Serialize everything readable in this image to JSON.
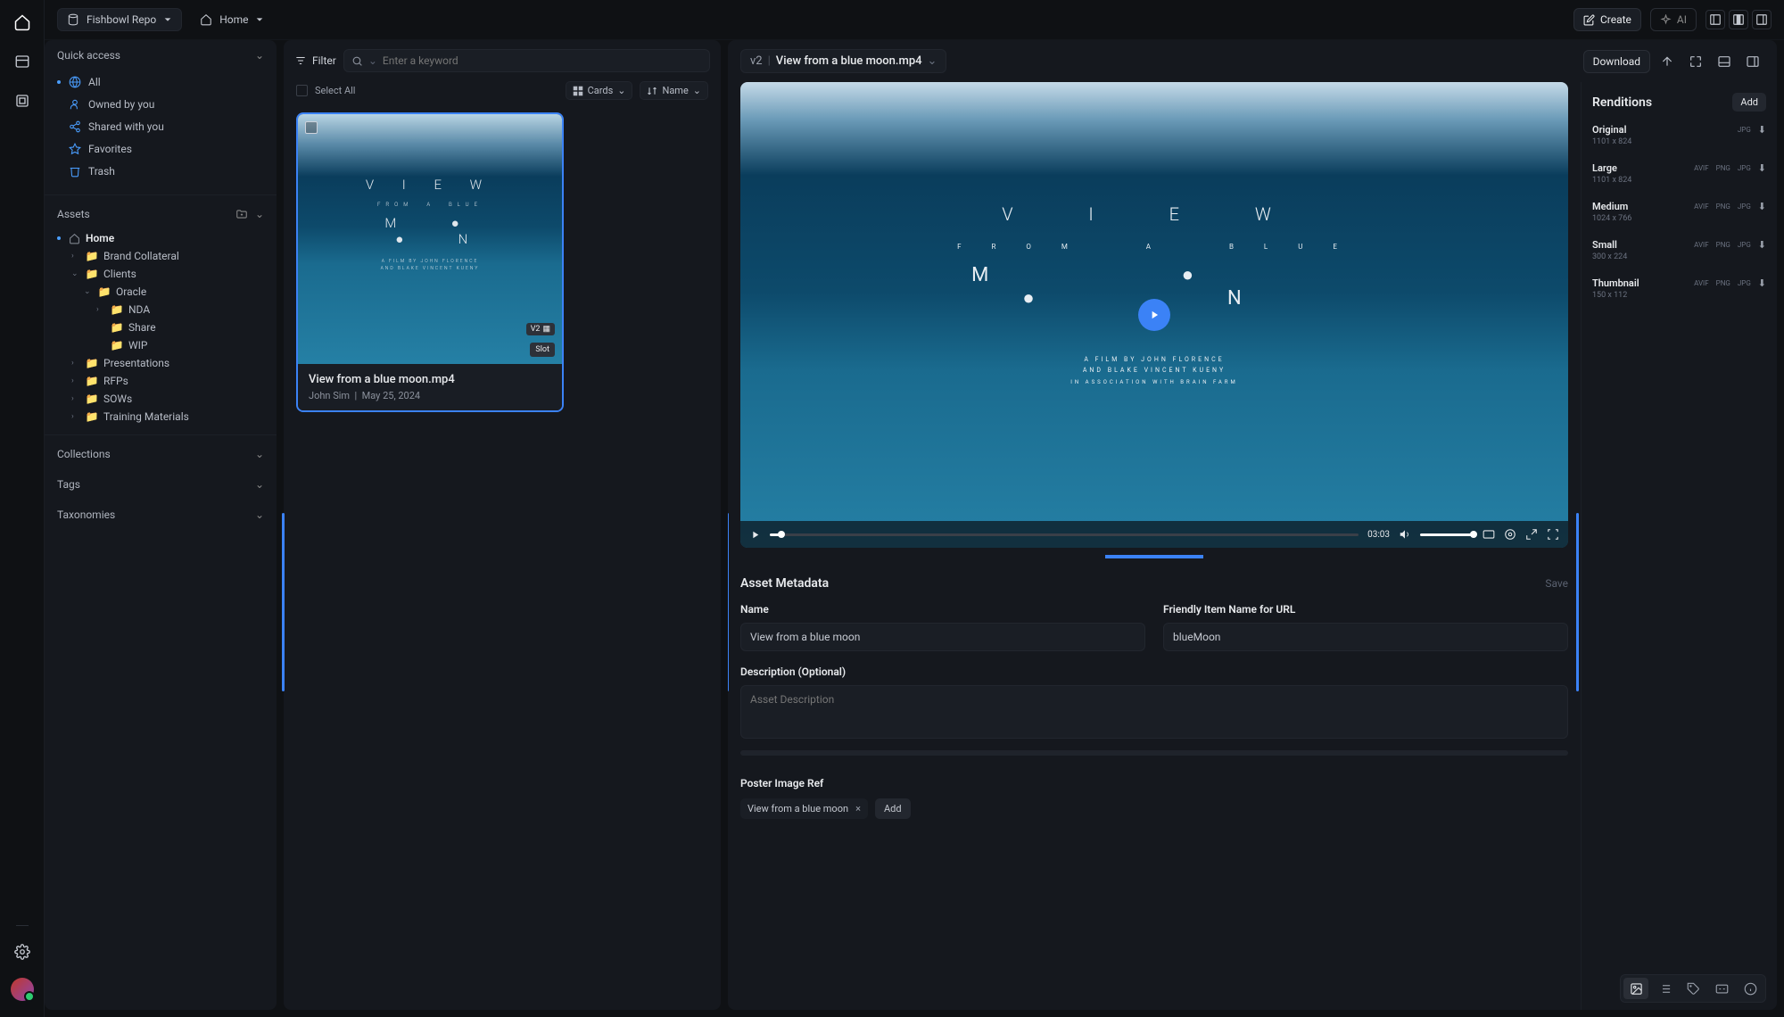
{
  "topbar": {
    "repo_label": "Fishbowl Repo",
    "breadcrumb_home": "Home",
    "create_label": "Create",
    "ai_label": "AI"
  },
  "sidebar": {
    "quick_access": {
      "title": "Quick access",
      "items": [
        {
          "label": "All",
          "icon": "globe",
          "current": true
        },
        {
          "label": "Owned by you",
          "icon": "user"
        },
        {
          "label": "Shared with you",
          "icon": "share"
        },
        {
          "label": "Favorites",
          "icon": "star"
        },
        {
          "label": "Trash",
          "icon": "trash"
        }
      ]
    },
    "assets": {
      "title": "Assets",
      "tree": {
        "home": "Home",
        "brand": "Brand Collateral",
        "clients": "Clients",
        "oracle": "Oracle",
        "nda": "NDA",
        "share": "Share",
        "wip": "WIP",
        "presentations": "Presentations",
        "rfps": "RFPs",
        "sows": "SOWs",
        "training": "Training Materials"
      }
    },
    "collections": "Collections",
    "tags": "Tags",
    "taxonomies": "Taxonomies"
  },
  "middle": {
    "filter_label": "Filter",
    "search_placeholder": "Enter a keyword",
    "select_all": "Select All",
    "view_label": "Cards",
    "sort_label": "Name",
    "card": {
      "title": "View from a blue moon.mp4",
      "author": "John Sim",
      "date": "May 25, 2024",
      "version": "V2",
      "slot": "Slot"
    }
  },
  "detail": {
    "version": "v2",
    "filename": "View from a blue moon.mp4",
    "download": "Download",
    "video": {
      "duration": "03:03"
    },
    "metadata": {
      "heading": "Asset Metadata",
      "save": "Save",
      "name_label": "Name",
      "name_value": "View from a blue moon",
      "friendly_label": "Friendly Item Name for URL",
      "friendly_value": "blueMoon",
      "desc_label": "Description (Optional)",
      "desc_placeholder": "Asset Description",
      "poster_label": "Poster Image Ref",
      "poster_chip": "View from a blue moon",
      "add": "Add"
    }
  },
  "renditions": {
    "heading": "Renditions",
    "add": "Add",
    "items": [
      {
        "name": "Original",
        "dim": "1101 x 824",
        "formats": [
          "JPG"
        ]
      },
      {
        "name": "Large",
        "dim": "1101 x 824",
        "formats": [
          "AVIF",
          "PNG",
          "JPG"
        ]
      },
      {
        "name": "Medium",
        "dim": "1024 x 766",
        "formats": [
          "AVIF",
          "PNG",
          "JPG"
        ]
      },
      {
        "name": "Small",
        "dim": "300 x 224",
        "formats": [
          "AVIF",
          "PNG",
          "JPG"
        ]
      },
      {
        "name": "Thumbnail",
        "dim": "150 x 112",
        "formats": [
          "AVIF",
          "PNG",
          "JPG"
        ]
      }
    ]
  }
}
